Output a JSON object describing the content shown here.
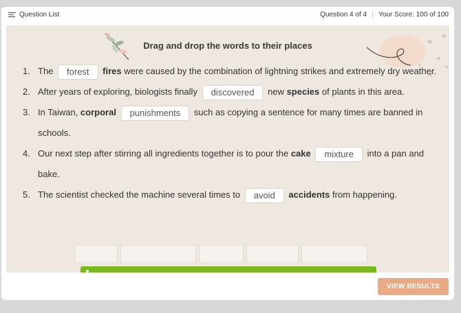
{
  "header": {
    "question_list_label": "Question List",
    "progress": "Question 4 of 4",
    "score": "Your Score: 100 of 100"
  },
  "activity": {
    "title": "Drag and drop the words to their places",
    "questions": [
      {
        "num": "1.",
        "before": "The",
        "blank": "forest",
        "bold": "fires",
        "after": "were caused by the combination of lightning strikes and extremely dry weather."
      },
      {
        "num": "2.",
        "before": "After years of exploring, biologists finally",
        "blank": "discovered",
        "mid": "new",
        "bold": "species",
        "after": "of plants in this area."
      },
      {
        "num": "3.",
        "before": "In Taiwan,",
        "bold": "corporal",
        "blank": "punishments",
        "after": "such as copying a sentence for many times are banned in schools."
      },
      {
        "num": "4.",
        "before": "Our next step after stirring all ingredients together is to pour the",
        "bold": "cake",
        "blank": "mixture",
        "after": "into a pan and bake."
      },
      {
        "num": "5.",
        "before": "The scientist checked the machine several times to",
        "blank": "avoid",
        "bold": "accidents",
        "after": "from happening."
      }
    ]
  },
  "footer": {
    "view_results_label": "VIEW RESULTS"
  },
  "colors": {
    "content_bg": "#efe8e0",
    "button_bg": "#e9ab85",
    "feedback_bar": "#7ab81e"
  }
}
